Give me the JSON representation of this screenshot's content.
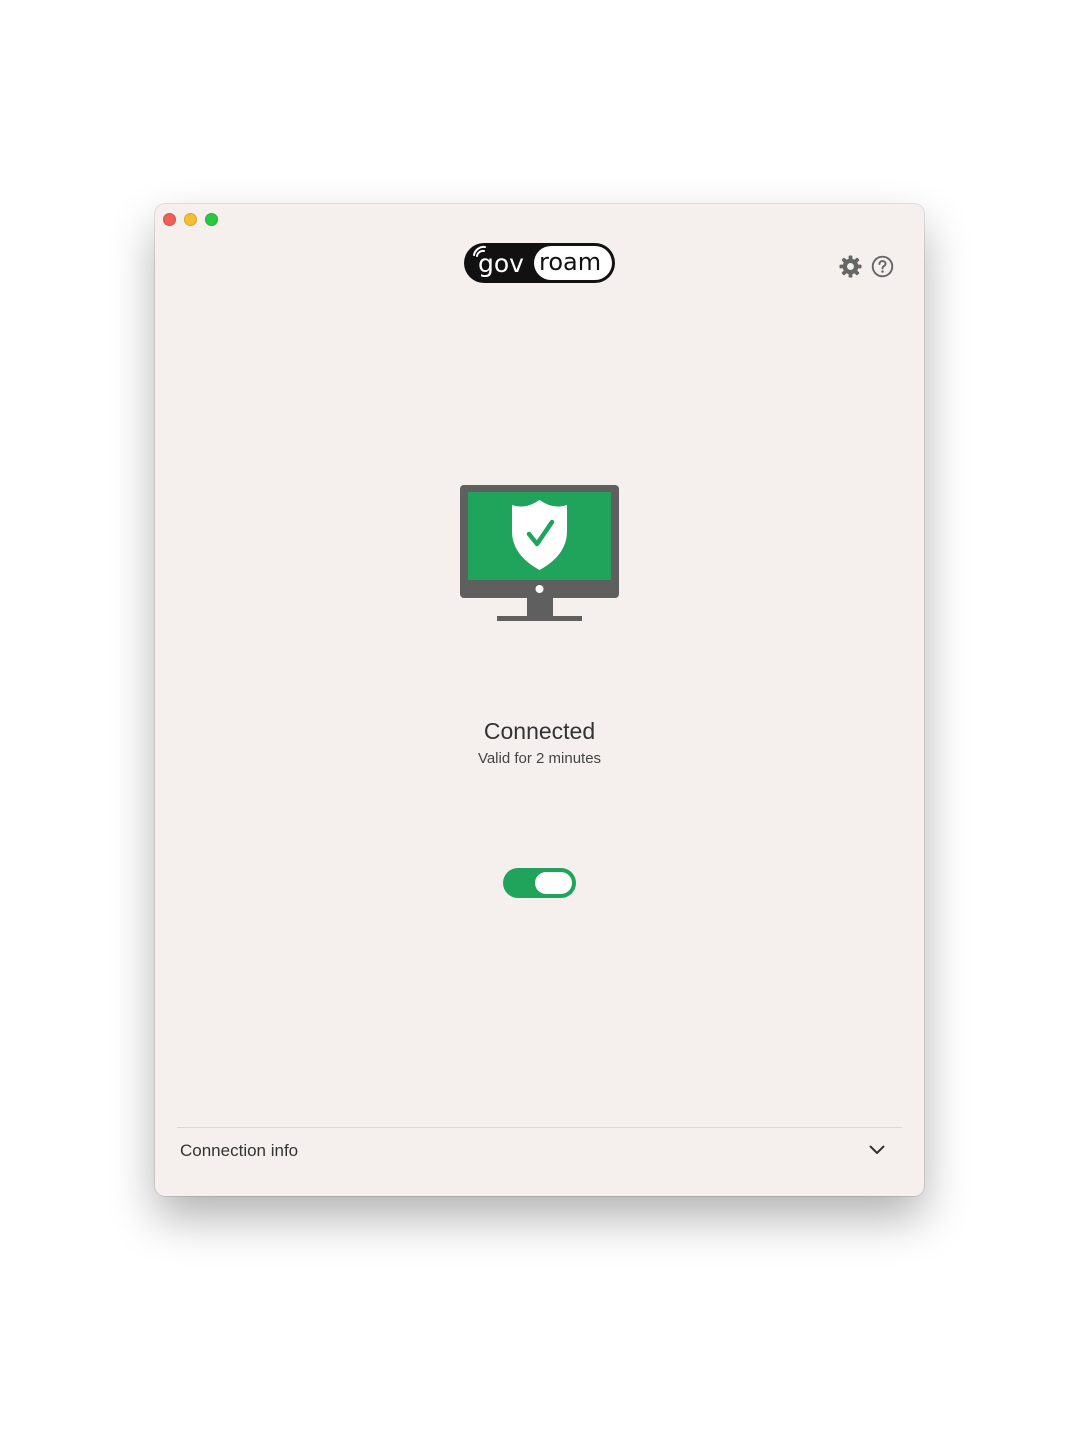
{
  "window": {
    "traffic_lights": {
      "close_color": "#ed5f57",
      "minimize_color": "#f5bd2f",
      "zoom_color": "#2ac840"
    }
  },
  "header": {
    "logo": {
      "left_text": "gov",
      "right_text": "roam"
    },
    "icons": [
      "gear-icon",
      "help-icon"
    ]
  },
  "status": {
    "title": "Connected",
    "subtitle": "Valid for 2 minutes",
    "connected": true,
    "illustration_icon": "monitor-shield-check-icon"
  },
  "toggle": {
    "on": true
  },
  "connection_info": {
    "label": "Connection info",
    "expanded": false,
    "icon": "chevron-down-icon"
  },
  "colors": {
    "accent_green": "#20a45c",
    "monitor_gray": "#5f5f5f",
    "window_bg": "#f5f0ed"
  }
}
